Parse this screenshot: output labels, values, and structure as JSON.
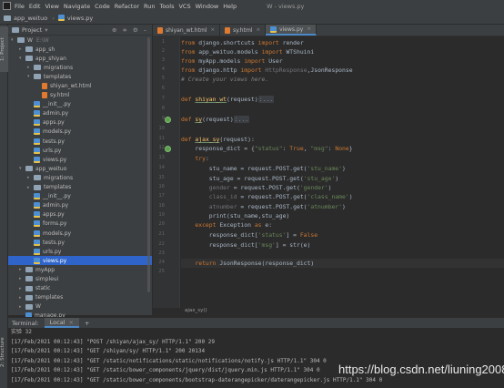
{
  "menubar": {
    "items": [
      "File",
      "Edit",
      "View",
      "Navigate",
      "Code",
      "Refactor",
      "Run",
      "Tools",
      "VCS",
      "Window",
      "Help"
    ],
    "window_title": "W - views.py"
  },
  "navbar": {
    "breadcrumbs": [
      "app_weituo",
      "views.py"
    ]
  },
  "left_strip": {
    "tabs": [
      "1: Project",
      "2: Structure"
    ]
  },
  "project_panel": {
    "title": "Project",
    "tree": [
      {
        "name": "W",
        "hint": "E:\\W",
        "kind": "folder",
        "depth": 0,
        "expanded": true
      },
      {
        "name": "app_sh",
        "kind": "folder",
        "depth": 1,
        "expanded": false
      },
      {
        "name": "app_shiyan",
        "kind": "folder",
        "depth": 1,
        "expanded": true
      },
      {
        "name": "migrations",
        "kind": "folder",
        "depth": 2,
        "expanded": false
      },
      {
        "name": "templates",
        "kind": "folder",
        "depth": 2,
        "expanded": true
      },
      {
        "name": "shiyan_wt.html",
        "kind": "html",
        "depth": 3
      },
      {
        "name": "sy.html",
        "kind": "html",
        "depth": 3
      },
      {
        "name": "__init__.py",
        "kind": "py",
        "depth": 2
      },
      {
        "name": "admin.py",
        "kind": "py",
        "depth": 2
      },
      {
        "name": "apps.py",
        "kind": "py",
        "depth": 2
      },
      {
        "name": "models.py",
        "kind": "py",
        "depth": 2
      },
      {
        "name": "tests.py",
        "kind": "py",
        "depth": 2
      },
      {
        "name": "urls.py",
        "kind": "py",
        "depth": 2
      },
      {
        "name": "views.py",
        "kind": "py",
        "depth": 2
      },
      {
        "name": "app_weituo",
        "kind": "folder",
        "depth": 1,
        "expanded": true
      },
      {
        "name": "migrations",
        "kind": "folder",
        "depth": 2,
        "expanded": false
      },
      {
        "name": "templates",
        "kind": "folder",
        "depth": 2,
        "expanded": false
      },
      {
        "name": "__init__.py",
        "kind": "py",
        "depth": 2
      },
      {
        "name": "admin.py",
        "kind": "py",
        "depth": 2
      },
      {
        "name": "apps.py",
        "kind": "py",
        "depth": 2
      },
      {
        "name": "forms.py",
        "kind": "py",
        "depth": 2
      },
      {
        "name": "models.py",
        "kind": "py",
        "depth": 2
      },
      {
        "name": "tests.py",
        "kind": "py",
        "depth": 2
      },
      {
        "name": "urls.py",
        "kind": "py",
        "depth": 2
      },
      {
        "name": "views.py",
        "kind": "py",
        "depth": 2,
        "selected": true
      },
      {
        "name": "myApp",
        "kind": "folder",
        "depth": 1,
        "expanded": false
      },
      {
        "name": "simpleui",
        "kind": "folder",
        "depth": 1,
        "expanded": false
      },
      {
        "name": "static",
        "kind": "folder",
        "depth": 1,
        "expanded": false
      },
      {
        "name": "templates",
        "kind": "folder",
        "depth": 1,
        "expanded": false
      },
      {
        "name": "W",
        "kind": "folder",
        "depth": 1,
        "expanded": false
      },
      {
        "name": "manage.py",
        "kind": "py",
        "depth": 1
      }
    ]
  },
  "editor": {
    "tabs": [
      {
        "label": "shiyan_wt.html",
        "kind": "html",
        "active": false
      },
      {
        "label": "sy.html",
        "kind": "html",
        "active": false
      },
      {
        "label": "views.py",
        "kind": "py",
        "active": true
      }
    ],
    "line_numbers": [
      "1",
      "2",
      "3",
      "4",
      "5",
      "6",
      "7",
      "8",
      "9",
      "10",
      "11",
      "12",
      "13",
      "14",
      "15",
      "16",
      "17",
      "18",
      "19",
      "20",
      "21",
      "22",
      "23",
      "24",
      "25"
    ],
    "gutter_run_icons_at_lines": [
      9,
      12
    ],
    "breadcrumb": "ajax_sy()"
  },
  "terminal": {
    "label": "Terminal:",
    "tab": "Local",
    "lines": [
      "实验 32",
      "[17/Feb/2021 00:12:43] \"POST /shiyan/ajax_sy/ HTTP/1.1\" 200 29",
      "[17/Feb/2021 00:12:43] \"GET /shiyan/sy/ HTTP/1.1\" 200 20134",
      "[17/Feb/2021 00:12:43] \"GET /static/notifications/static/notifications/notify.js HTTP/1.1\" 304 0",
      "[17/Feb/2021 00:12:43] \"GET /static/bower_components/jquery/dist/jquery.min.js HTTP/1.1\" 304 0",
      "[17/Feb/2021 00:12:43] \"GET /static/bower_components/bootstrap-daterangepicker/daterangepicker.js HTTP/1.1\" 304 0"
    ]
  },
  "watermark": "https://blog.csdn.net/liuning2008"
}
